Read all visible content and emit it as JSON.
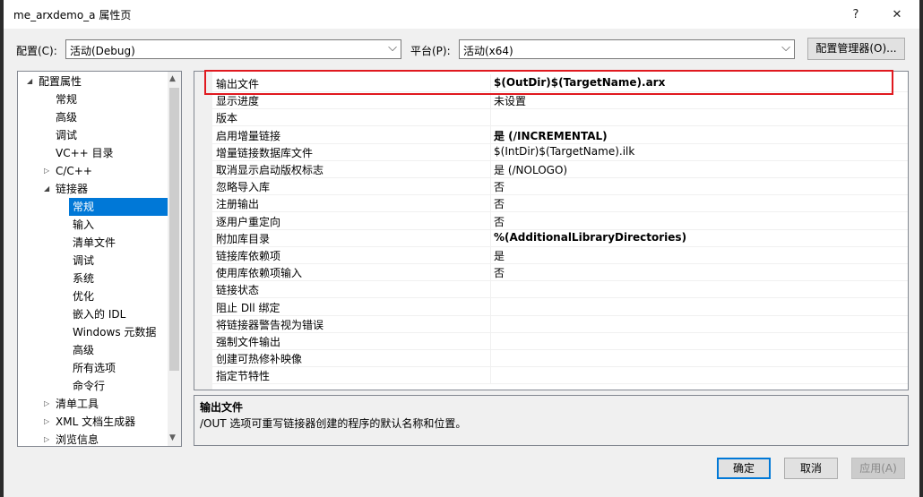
{
  "window": {
    "title": "me_arxdemo_a 属性页",
    "help_glyph": "?",
    "close_glyph": "✕"
  },
  "config_bar": {
    "config_label": "配置(C):",
    "config_value": "活动(Debug)",
    "platform_label": "平台(P):",
    "platform_value": "活动(x64)",
    "manager_button": "配置管理器(O)..."
  },
  "tree": {
    "items": [
      {
        "label": "配置属性",
        "level": 0,
        "expander": "◢"
      },
      {
        "label": "常规",
        "level": 1,
        "expander": ""
      },
      {
        "label": "高级",
        "level": 1,
        "expander": ""
      },
      {
        "label": "调试",
        "level": 1,
        "expander": ""
      },
      {
        "label": "VC++ 目录",
        "level": 1,
        "expander": ""
      },
      {
        "label": "C/C++",
        "level": 1,
        "expander": "▷"
      },
      {
        "label": "链接器",
        "level": 1,
        "expander": "◢"
      },
      {
        "label": "常规",
        "level": 2,
        "expander": "",
        "selected": true
      },
      {
        "label": "输入",
        "level": 2,
        "expander": ""
      },
      {
        "label": "清单文件",
        "level": 2,
        "expander": ""
      },
      {
        "label": "调试",
        "level": 2,
        "expander": ""
      },
      {
        "label": "系统",
        "level": 2,
        "expander": ""
      },
      {
        "label": "优化",
        "level": 2,
        "expander": ""
      },
      {
        "label": "嵌入的 IDL",
        "level": 2,
        "expander": ""
      },
      {
        "label": "Windows 元数据",
        "level": 2,
        "expander": ""
      },
      {
        "label": "高级",
        "level": 2,
        "expander": ""
      },
      {
        "label": "所有选项",
        "level": 2,
        "expander": ""
      },
      {
        "label": "命令行",
        "level": 2,
        "expander": ""
      },
      {
        "label": "清单工具",
        "level": 1,
        "expander": "▷"
      },
      {
        "label": "XML 文档生成器",
        "level": 1,
        "expander": "▷"
      },
      {
        "label": "浏览信息",
        "level": 1,
        "expander": "▷"
      }
    ]
  },
  "grid": {
    "rows": [
      {
        "name": "输出文件",
        "value": "$(OutDir)$(TargetName).arx",
        "bold": true
      },
      {
        "name": "显示进度",
        "value": "未设置",
        "bold": false
      },
      {
        "name": "版本",
        "value": "",
        "bold": false
      },
      {
        "name": "启用增量链接",
        "value": "是 (/INCREMENTAL)",
        "bold": true
      },
      {
        "name": "增量链接数据库文件",
        "value": "$(IntDir)$(TargetName).ilk",
        "bold": false
      },
      {
        "name": "取消显示启动版权标志",
        "value": "是 (/NOLOGO)",
        "bold": false
      },
      {
        "name": "忽略导入库",
        "value": "否",
        "bold": false
      },
      {
        "name": "注册输出",
        "value": "否",
        "bold": false
      },
      {
        "name": "逐用户重定向",
        "value": "否",
        "bold": false
      },
      {
        "name": "附加库目录",
        "value": "%(AdditionalLibraryDirectories)",
        "bold": true
      },
      {
        "name": "链接库依赖项",
        "value": "是",
        "bold": false
      },
      {
        "name": "使用库依赖项输入",
        "value": "否",
        "bold": false
      },
      {
        "name": "链接状态",
        "value": "",
        "bold": false
      },
      {
        "name": "阻止 Dll 绑定",
        "value": "",
        "bold": false
      },
      {
        "name": "将链接器警告视为错误",
        "value": "",
        "bold": false
      },
      {
        "name": "强制文件输出",
        "value": "",
        "bold": false
      },
      {
        "name": "创建可热修补映像",
        "value": "",
        "bold": false
      },
      {
        "name": "指定节特性",
        "value": "",
        "bold": false
      }
    ]
  },
  "description": {
    "title": "输出文件",
    "text": "/OUT 选项可重写链接器创建的程序的默认名称和位置。"
  },
  "buttons": {
    "ok": "确定",
    "cancel": "取消",
    "apply": "应用(A)"
  },
  "colors": {
    "selection": "#0078d7",
    "highlight_box": "#e0191f"
  }
}
